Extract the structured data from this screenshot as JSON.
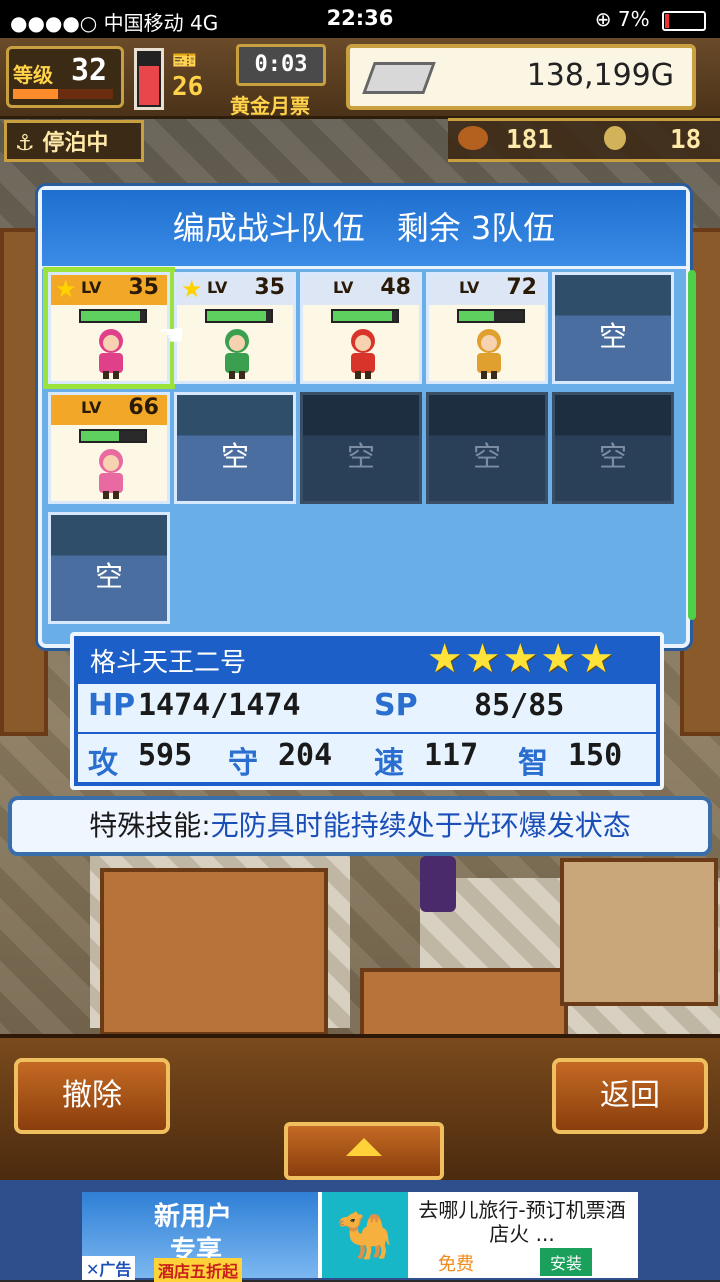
{
  "status_bar": {
    "carrier": "●●●●○ 中国移动   4G",
    "time": "22:36",
    "battery": "7%"
  },
  "hud": {
    "level_label": "等级",
    "level_value": "32",
    "level_progress": 0.45,
    "stamina_fraction": 0.7,
    "gold_ticket_count": "26",
    "gold_ticket_label": "黄金月票",
    "timer": "0:03",
    "gold": "138,199G",
    "docked_label": "停泊中",
    "resource_a": "181",
    "resource_b": "18"
  },
  "panel": {
    "title": "编成战斗队伍　剩余 3队伍",
    "empty_label": "空",
    "lv_label": "LV",
    "slots": [
      {
        "type": "unit",
        "level": "35",
        "star": true,
        "hp": 0.92,
        "color": "#e0408a"
      },
      {
        "type": "unit",
        "level": "35",
        "star": true,
        "hp": 0.92,
        "color": "#3aa050"
      },
      {
        "type": "unit",
        "level": "48",
        "star": false,
        "hp": 0.92,
        "color": "#d8342a"
      },
      {
        "type": "unit",
        "level": "72",
        "star": false,
        "hp": 0.55,
        "color": "#e0a030"
      },
      {
        "type": "empty"
      },
      {
        "type": "unit",
        "level": "66",
        "star": false,
        "hp": 0.6,
        "color": "#e86aa0"
      },
      {
        "type": "empty"
      },
      {
        "type": "locked"
      },
      {
        "type": "locked"
      },
      {
        "type": "locked"
      },
      {
        "type": "empty"
      }
    ]
  },
  "info": {
    "name": "格斗天王二号",
    "stars": "★★★★★",
    "hp_label": "HP",
    "hp_value": "1474/1474",
    "sp_label": "SP",
    "sp_value": "85/85",
    "atk_label": "攻",
    "atk_value": "595",
    "def_label": "守",
    "def_value": "204",
    "spd_label": "速",
    "spd_value": "117",
    "int_label": "智",
    "int_value": "150"
  },
  "skill": {
    "label": "特殊技能:",
    "value": "无防具时能持续处于光环爆发状态"
  },
  "buttons": {
    "remove": "撤除",
    "back": "返回"
  },
  "ad": {
    "promo_line1": "新用户",
    "promo_line2": "专享",
    "promo_line3": "酒店五折起",
    "ad_label": "✕广告",
    "title": "去哪儿旅行-预订机票酒店火 ...",
    "free": "免费",
    "install": "安装"
  }
}
